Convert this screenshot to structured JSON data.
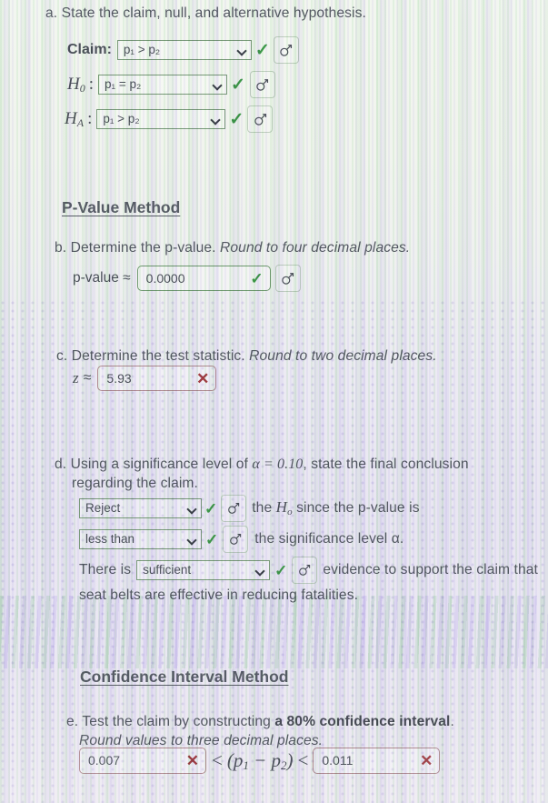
{
  "part_a": {
    "prompt": "a. State the claim, null, and alternative hypothesis.",
    "claim_label": "Claim:",
    "claim_value": "p₁ > p₂",
    "h0_label_base": "H",
    "h0_label_sub": "0",
    "h0_colon": ":",
    "h0_value": "p₁ = p₂",
    "ha_label_base": "H",
    "ha_label_sub": "A",
    "ha_colon": ":",
    "ha_value": "p₁ > p₂",
    "check_mark": "✓",
    "hint_icon": "mars-symbol"
  },
  "pvalue_section": {
    "heading": "P-Value Method",
    "part_b_prompt_plain": "b. Determine the p-value. ",
    "part_b_prompt_italic": "Round to four decimal places.",
    "pvalue_label": "p-value ≈",
    "pvalue_value": "0.0000",
    "pvalue_status": "✓",
    "part_c_prompt_plain": "c. Determine the test statistic. ",
    "part_c_prompt_italic": "Round to two decimal places.",
    "z_label": "z",
    "z_approx": "≈",
    "z_value": "5.93",
    "z_status": "✕"
  },
  "part_d": {
    "prompt_line1_a": "d. Using a significance level of ",
    "prompt_line1_alpha": "α = 0.10",
    "prompt_line1_b": ", state the final conclusion",
    "prompt_line2": "regarding the claim.",
    "decision_value": "Reject",
    "decision_status": "✓",
    "after_decision_a": "the ",
    "after_decision_h": "H",
    "after_decision_hsub": "o",
    "after_decision_b": " since the p-value is",
    "comparison_value": "less than",
    "comparison_status": "✓",
    "after_comparison": "the significance level α.",
    "there_is_label": "There is",
    "sufficiency_value": "sufficient",
    "sufficiency_status": "✓",
    "after_sufficiency": "evidence to support the claim that",
    "final_line": "seat belts are effective in reducing fatalities."
  },
  "ci_section": {
    "heading": "Confidence Interval Method",
    "part_e_plain1": "e. Test the claim by constructing ",
    "part_e_bold": "a 80% confidence interval",
    "part_e_plain2": ".",
    "part_e_italic": "Round values to three decimal places.",
    "lower_value": "0.007",
    "lower_status": "✕",
    "mid_lt_left": "<",
    "mid_expr_p1": "p",
    "mid_expr_p1sub": "1",
    "mid_expr_minus": " − ",
    "mid_expr_p2": "p",
    "mid_expr_p2sub": "2",
    "mid_lt_right": "<",
    "upper_value": "0.011",
    "upper_status": "✕"
  },
  "colors": {
    "correct_green": "#3f9b4a",
    "incorrect_red": "#a33c42",
    "select_border": "#7a9b7a",
    "input_border": "#6f9a6f",
    "input_border_bad": "#b08a90",
    "text": "#555a63",
    "heading": "#5a5f68"
  }
}
